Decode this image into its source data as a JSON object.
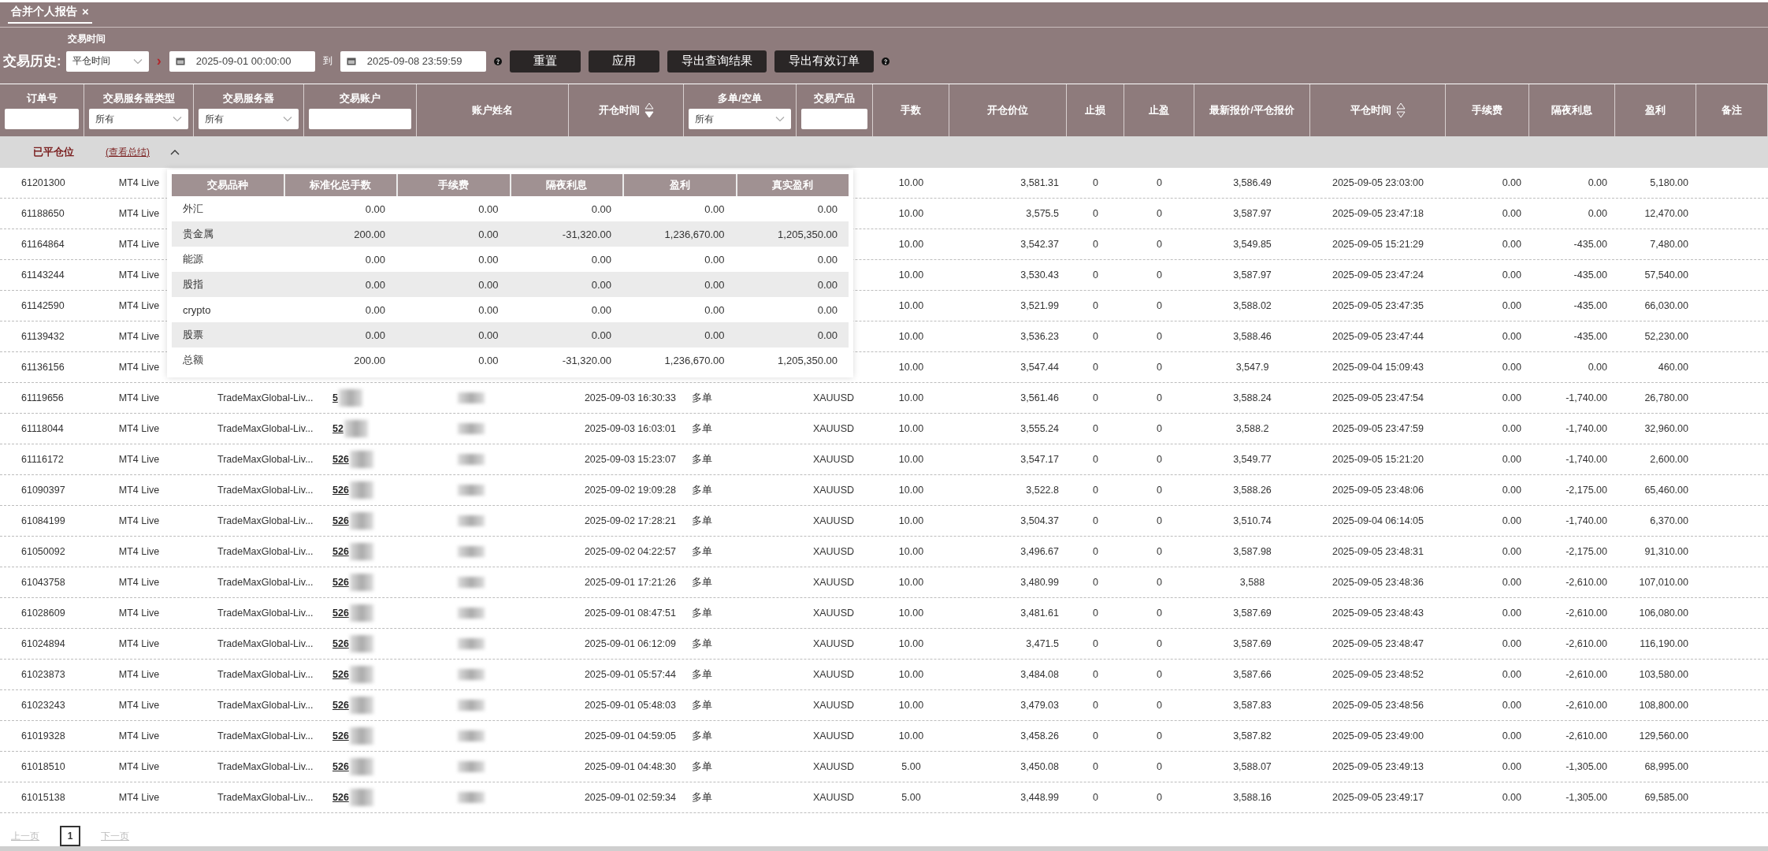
{
  "tab": {
    "label": "合并个人报告",
    "close": "×"
  },
  "filters": {
    "time_label": "交易时间",
    "history_label": "交易历史:",
    "time_type": "平仓时间",
    "arrow": "›",
    "date_from": "2025-09-01 00:00:00",
    "to_label": "到",
    "date_to": "2025-09-08 23:59:59",
    "buttons": [
      "重置",
      "应用",
      "导出查询结果",
      "导出有效订单"
    ]
  },
  "columns": [
    {
      "label": "订单号",
      "filter": {
        "kind": "input"
      }
    },
    {
      "label": "交易服务器类型",
      "filter": {
        "kind": "select",
        "value": "所有"
      }
    },
    {
      "label": "交易服务器",
      "filter": {
        "kind": "select",
        "value": "所有"
      }
    },
    {
      "label": "交易账户",
      "filter": {
        "kind": "input"
      }
    },
    {
      "label": "账户姓名"
    },
    {
      "label": "开仓时间",
      "sortable": true,
      "sorted_desc": true
    },
    {
      "label": "多单/空单",
      "filter": {
        "kind": "select",
        "value": "所有"
      }
    },
    {
      "label": "交易产品",
      "filter": {
        "kind": "input"
      }
    },
    {
      "label": "手数"
    },
    {
      "label": "开仓价位"
    },
    {
      "label": "止损"
    },
    {
      "label": "止盈"
    },
    {
      "label": "最新报价/平仓报价"
    },
    {
      "label": "平仓时间",
      "sortable": true,
      "sorted_desc": false
    },
    {
      "label": "手续费"
    },
    {
      "label": "隔夜利息"
    },
    {
      "label": "盈利"
    },
    {
      "label": "备注"
    }
  ],
  "group": {
    "label": "已平仓位",
    "link": "(查看总结)",
    "expanded": true
  },
  "summary": {
    "columns": [
      "交易品种",
      "标准化总手数",
      "手续费",
      "隔夜利息",
      "盈利",
      "真实盈利"
    ],
    "rows": [
      [
        "外汇",
        "0.00",
        "0.00",
        "0.00",
        "0.00",
        "0.00"
      ],
      [
        "贵金属",
        "200.00",
        "0.00",
        "-31,320.00",
        "1,236,670.00",
        "1,205,350.00"
      ],
      [
        "能源",
        "0.00",
        "0.00",
        "0.00",
        "0.00",
        "0.00"
      ],
      [
        "股指",
        "0.00",
        "0.00",
        "0.00",
        "0.00",
        "0.00"
      ],
      [
        "crypto",
        "0.00",
        "0.00",
        "0.00",
        "0.00",
        "0.00"
      ],
      [
        "股票",
        "0.00",
        "0.00",
        "0.00",
        "0.00",
        "0.00"
      ],
      [
        "总额",
        "200.00",
        "0.00",
        "-31,320.00",
        "1,236,670.00",
        "1,205,350.00"
      ]
    ]
  },
  "rows": [
    {
      "order": "61201300",
      "server_type": "MT4 Live",
      "lots": "10.00",
      "open_price": "3,581.31",
      "sl": "0",
      "tp": "0",
      "close_price": "3,586.49",
      "close_time": "2025-09-05 23:03:00",
      "fee": "0.00",
      "swap": "0.00",
      "profit": "5,180.00"
    },
    {
      "order": "61188650",
      "server_type": "MT4 Live",
      "lots": "10.00",
      "open_price": "3,575.5",
      "sl": "0",
      "tp": "0",
      "close_price": "3,587.97",
      "close_time": "2025-09-05 23:47:18",
      "fee": "0.00",
      "swap": "0.00",
      "profit": "12,470.00"
    },
    {
      "order": "61164864",
      "server_type": "MT4 Live",
      "lots": "10.00",
      "open_price": "3,542.37",
      "sl": "0",
      "tp": "0",
      "close_price": "3,549.85",
      "close_time": "2025-09-05 15:21:29",
      "fee": "0.00",
      "swap": "-435.00",
      "profit": "7,480.00"
    },
    {
      "order": "61143244",
      "server_type": "MT4 Live",
      "lots": "10.00",
      "open_price": "3,530.43",
      "sl": "0",
      "tp": "0",
      "close_price": "3,587.97",
      "close_time": "2025-09-05 23:47:24",
      "fee": "0.00",
      "swap": "-435.00",
      "profit": "57,540.00"
    },
    {
      "order": "61142590",
      "server_type": "MT4 Live",
      "lots": "10.00",
      "open_price": "3,521.99",
      "sl": "0",
      "tp": "0",
      "close_price": "3,588.02",
      "close_time": "2025-09-05 23:47:35",
      "fee": "0.00",
      "swap": "-435.00",
      "profit": "66,030.00"
    },
    {
      "order": "61139432",
      "server_type": "MT4 Live",
      "lots": "10.00",
      "open_price": "3,536.23",
      "sl": "0",
      "tp": "0",
      "close_price": "3,588.46",
      "close_time": "2025-09-05 23:47:44",
      "fee": "0.00",
      "swap": "-435.00",
      "profit": "52,230.00"
    },
    {
      "order": "61136156",
      "server_type": "MT4 Live",
      "lots": "10.00",
      "open_price": "3,547.44",
      "sl": "0",
      "tp": "0",
      "close_price": "3,547.9",
      "close_time": "2025-09-04 15:09:43",
      "fee": "0.00",
      "swap": "0.00",
      "profit": "460.00"
    },
    {
      "order": "61119656",
      "server_type": "MT4 Live",
      "server": "TradeMaxGlobal-Liv...",
      "account": "5",
      "masked": true,
      "open_time": "2025-09-03 16:30:33",
      "side": "多单",
      "product": "XAUUSD",
      "lots": "10.00",
      "open_price": "3,561.46",
      "sl": "0",
      "tp": "0",
      "close_price": "3,588.24",
      "close_time": "2025-09-05 23:47:54",
      "fee": "0.00",
      "swap": "-1,740.00",
      "profit": "26,780.00"
    },
    {
      "order": "61118044",
      "server_type": "MT4 Live",
      "server": "TradeMaxGlobal-Liv...",
      "account": "52",
      "masked": true,
      "open_time": "2025-09-03 16:03:01",
      "side": "多单",
      "product": "XAUUSD",
      "lots": "10.00",
      "open_price": "3,555.24",
      "sl": "0",
      "tp": "0",
      "close_price": "3,588.2",
      "close_time": "2025-09-05 23:47:59",
      "fee": "0.00",
      "swap": "-1,740.00",
      "profit": "32,960.00"
    },
    {
      "order": "61116172",
      "server_type": "MT4 Live",
      "server": "TradeMaxGlobal-Liv...",
      "account": "526",
      "masked": true,
      "open_time": "2025-09-03 15:23:07",
      "side": "多单",
      "product": "XAUUSD",
      "lots": "10.00",
      "open_price": "3,547.17",
      "sl": "0",
      "tp": "0",
      "close_price": "3,549.77",
      "close_time": "2025-09-05 15:21:20",
      "fee": "0.00",
      "swap": "-1,740.00",
      "profit": "2,600.00"
    },
    {
      "order": "61090397",
      "server_type": "MT4 Live",
      "server": "TradeMaxGlobal-Liv...",
      "account": "526",
      "masked": true,
      "open_time": "2025-09-02 19:09:28",
      "side": "多单",
      "product": "XAUUSD",
      "lots": "10.00",
      "open_price": "3,522.8",
      "sl": "0",
      "tp": "0",
      "close_price": "3,588.26",
      "close_time": "2025-09-05 23:48:06",
      "fee": "0.00",
      "swap": "-2,175.00",
      "profit": "65,460.00"
    },
    {
      "order": "61084199",
      "server_type": "MT4 Live",
      "server": "TradeMaxGlobal-Liv...",
      "account": "526",
      "masked": true,
      "open_time": "2025-09-02 17:28:21",
      "side": "多单",
      "product": "XAUUSD",
      "lots": "10.00",
      "open_price": "3,504.37",
      "sl": "0",
      "tp": "0",
      "close_price": "3,510.74",
      "close_time": "2025-09-04 06:14:05",
      "fee": "0.00",
      "swap": "-1,740.00",
      "profit": "6,370.00"
    },
    {
      "order": "61050092",
      "server_type": "MT4 Live",
      "server": "TradeMaxGlobal-Liv...",
      "account": "526",
      "masked": true,
      "open_time": "2025-09-02 04:22:57",
      "side": "多单",
      "product": "XAUUSD",
      "lots": "10.00",
      "open_price": "3,496.67",
      "sl": "0",
      "tp": "0",
      "close_price": "3,587.98",
      "close_time": "2025-09-05 23:48:31",
      "fee": "0.00",
      "swap": "-2,175.00",
      "profit": "91,310.00"
    },
    {
      "order": "61043758",
      "server_type": "MT4 Live",
      "server": "TradeMaxGlobal-Liv...",
      "account": "526",
      "masked": true,
      "open_time": "2025-09-01 17:21:26",
      "side": "多单",
      "product": "XAUUSD",
      "lots": "10.00",
      "open_price": "3,480.99",
      "sl": "0",
      "tp": "0",
      "close_price": "3,588",
      "close_time": "2025-09-05 23:48:36",
      "fee": "0.00",
      "swap": "-2,610.00",
      "profit": "107,010.00"
    },
    {
      "order": "61028609",
      "server_type": "MT4 Live",
      "server": "TradeMaxGlobal-Liv...",
      "account": "526",
      "masked": true,
      "open_time": "2025-09-01 08:47:51",
      "side": "多单",
      "product": "XAUUSD",
      "lots": "10.00",
      "open_price": "3,481.61",
      "sl": "0",
      "tp": "0",
      "close_price": "3,587.69",
      "close_time": "2025-09-05 23:48:43",
      "fee": "0.00",
      "swap": "-2,610.00",
      "profit": "106,080.00"
    },
    {
      "order": "61024894",
      "server_type": "MT4 Live",
      "server": "TradeMaxGlobal-Liv...",
      "account": "526",
      "masked": true,
      "open_time": "2025-09-01 06:12:09",
      "side": "多单",
      "product": "XAUUSD",
      "lots": "10.00",
      "open_price": "3,471.5",
      "sl": "0",
      "tp": "0",
      "close_price": "3,587.69",
      "close_time": "2025-09-05 23:48:47",
      "fee": "0.00",
      "swap": "-2,610.00",
      "profit": "116,190.00"
    },
    {
      "order": "61023873",
      "server_type": "MT4 Live",
      "server": "TradeMaxGlobal-Liv...",
      "account": "526",
      "masked": true,
      "open_time": "2025-09-01 05:57:44",
      "side": "多单",
      "product": "XAUUSD",
      "lots": "10.00",
      "open_price": "3,484.08",
      "sl": "0",
      "tp": "0",
      "close_price": "3,587.66",
      "close_time": "2025-09-05 23:48:52",
      "fee": "0.00",
      "swap": "-2,610.00",
      "profit": "103,580.00"
    },
    {
      "order": "61023243",
      "server_type": "MT4 Live",
      "server": "TradeMaxGlobal-Liv...",
      "account": "526",
      "masked": true,
      "open_time": "2025-09-01 05:48:03",
      "side": "多单",
      "product": "XAUUSD",
      "lots": "10.00",
      "open_price": "3,479.03",
      "sl": "0",
      "tp": "0",
      "close_price": "3,587.83",
      "close_time": "2025-09-05 23:48:56",
      "fee": "0.00",
      "swap": "-2,610.00",
      "profit": "108,800.00"
    },
    {
      "order": "61019328",
      "server_type": "MT4 Live",
      "server": "TradeMaxGlobal-Liv...",
      "account": "526",
      "masked": true,
      "open_time": "2025-09-01 04:59:05",
      "side": "多单",
      "product": "XAUUSD",
      "lots": "10.00",
      "open_price": "3,458.26",
      "sl": "0",
      "tp": "0",
      "close_price": "3,587.82",
      "close_time": "2025-09-05 23:49:00",
      "fee": "0.00",
      "swap": "-2,610.00",
      "profit": "129,560.00"
    },
    {
      "order": "61018510",
      "server_type": "MT4 Live",
      "server": "TradeMaxGlobal-Liv...",
      "account": "526",
      "masked": true,
      "open_time": "2025-09-01 04:48:30",
      "side": "多单",
      "product": "XAUUSD",
      "lots": "5.00",
      "open_price": "3,450.08",
      "sl": "0",
      "tp": "0",
      "close_price": "3,588.07",
      "close_time": "2025-09-05 23:49:13",
      "fee": "0.00",
      "swap": "-1,305.00",
      "profit": "68,995.00"
    },
    {
      "order": "61015138",
      "server_type": "MT4 Live",
      "server": "TradeMaxGlobal-Liv...",
      "account": "526",
      "masked": true,
      "open_time": "2025-09-01 02:59:34",
      "side": "多单",
      "product": "XAUUSD",
      "lots": "5.00",
      "open_price": "3,448.99",
      "sl": "0",
      "tp": "0",
      "close_price": "3,588.16",
      "close_time": "2025-09-05 23:49:17",
      "fee": "0.00",
      "swap": "-1,305.00",
      "profit": "69,585.00"
    }
  ],
  "pagination": {
    "prev": "上一页",
    "pages": [
      {
        "label": "1",
        "selected": true
      }
    ],
    "next": "下一页"
  }
}
